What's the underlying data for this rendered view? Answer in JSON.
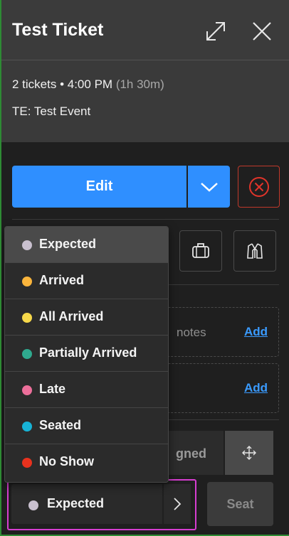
{
  "header": {
    "title": "Test Ticket"
  },
  "info": {
    "summary": "2 tickets • 4:00 PM",
    "duration": "(1h 30m)",
    "event": "TE: Test Event"
  },
  "actions": {
    "edit_label": "Edit"
  },
  "rows": {
    "notes_label": "notes",
    "add1": "Add",
    "add2": "Add"
  },
  "assignment": {
    "text": "gned"
  },
  "status": {
    "selected": "Expected",
    "seat_label": "Seat"
  },
  "menu": {
    "items": [
      {
        "label": "Expected",
        "color": "#c9c0cf"
      },
      {
        "label": "Arrived",
        "color": "#fbb53c"
      },
      {
        "label": "All Arrived",
        "color": "#f6d84a"
      },
      {
        "label": "Partially Arrived",
        "color": "#2faa8f"
      },
      {
        "label": "Late",
        "color": "#ec6f9a"
      },
      {
        "label": "Seated",
        "color": "#17b3d6"
      },
      {
        "label": "No Show",
        "color": "#e8321e"
      }
    ]
  },
  "colors": {
    "accent": "#2f8fff",
    "danger": "#c0392b",
    "highlight": "#d63dd0"
  },
  "icons": [
    "expand-icon",
    "close-icon",
    "chevron-down-icon",
    "cancel-circle-icon",
    "briefcase-icon",
    "jacket-icon",
    "move-icon",
    "chevron-right-icon"
  ]
}
